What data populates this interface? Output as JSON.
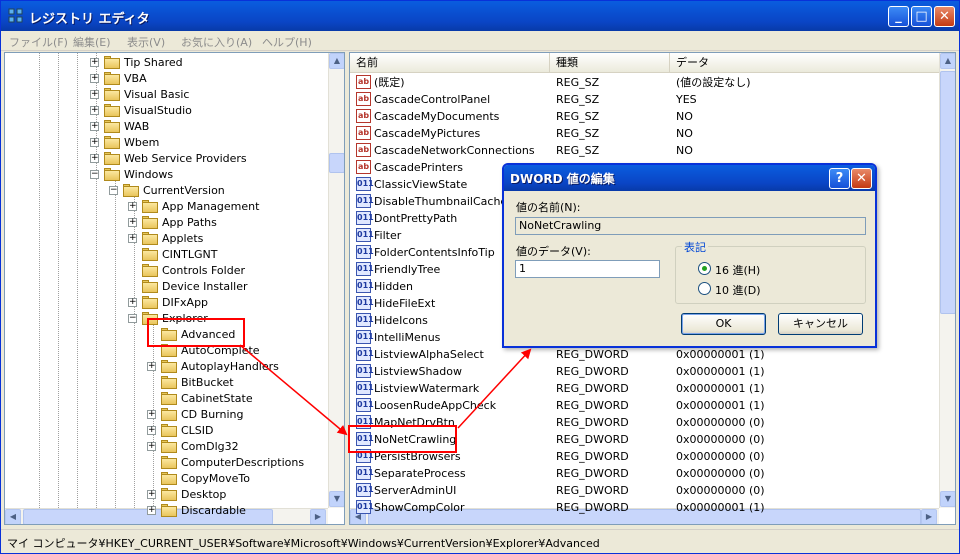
{
  "window": {
    "title": "レジストリ エディタ",
    "buttons": {
      "minimize": "_",
      "maximize": "□",
      "close": "✕"
    }
  },
  "menu": [
    "ファイル(F)",
    "編集(E)",
    "表示(V)",
    "お気に入り(A)",
    "ヘルプ(H)"
  ],
  "tree": {
    "items": [
      {
        "label": "Tip Shared",
        "level": 0,
        "exp": "+"
      },
      {
        "label": "VBA",
        "level": 0,
        "exp": "+"
      },
      {
        "label": "Visual Basic",
        "level": 0,
        "exp": "+"
      },
      {
        "label": "VisualStudio",
        "level": 0,
        "exp": "+"
      },
      {
        "label": "WAB",
        "level": 0,
        "exp": "+"
      },
      {
        "label": "Wbem",
        "level": 0,
        "exp": "+"
      },
      {
        "label": "Web Service Providers",
        "level": 0,
        "exp": "+"
      },
      {
        "label": "Windows",
        "level": 0,
        "exp": "-"
      },
      {
        "label": "CurrentVersion",
        "level": 1,
        "exp": "-"
      },
      {
        "label": "App Management",
        "level": 2,
        "exp": "+"
      },
      {
        "label": "App Paths",
        "level": 2,
        "exp": "+"
      },
      {
        "label": "Applets",
        "level": 2,
        "exp": "+"
      },
      {
        "label": "CINTLGNT",
        "level": 2,
        "exp": ""
      },
      {
        "label": "Controls Folder",
        "level": 2,
        "exp": ""
      },
      {
        "label": "Device Installer",
        "level": 2,
        "exp": ""
      },
      {
        "label": "DIFxApp",
        "level": 2,
        "exp": "+"
      },
      {
        "label": "Explorer",
        "level": 2,
        "exp": "-"
      },
      {
        "label": "Advanced",
        "level": 3,
        "exp": ""
      },
      {
        "label": "AutoComplete",
        "level": 3,
        "exp": ""
      },
      {
        "label": "AutoplayHandlers",
        "level": 3,
        "exp": "+"
      },
      {
        "label": "BitBucket",
        "level": 3,
        "exp": ""
      },
      {
        "label": "CabinetState",
        "level": 3,
        "exp": ""
      },
      {
        "label": "CD Burning",
        "level": 3,
        "exp": "+"
      },
      {
        "label": "CLSID",
        "level": 3,
        "exp": "+"
      },
      {
        "label": "ComDlg32",
        "level": 3,
        "exp": "+"
      },
      {
        "label": "ComputerDescriptions",
        "level": 3,
        "exp": ""
      },
      {
        "label": "CopyMoveTo",
        "level": 3,
        "exp": ""
      },
      {
        "label": "Desktop",
        "level": 3,
        "exp": "+"
      },
      {
        "label": "Discardable",
        "level": 3,
        "exp": "+"
      }
    ]
  },
  "list": {
    "columns": [
      "名前",
      "種類",
      "データ"
    ],
    "rows": [
      {
        "icon": "ab",
        "name": "(既定)",
        "type": "REG_SZ",
        "data": "(値の設定なし)"
      },
      {
        "icon": "ab",
        "name": "CascadeControlPanel",
        "type": "REG_SZ",
        "data": "YES"
      },
      {
        "icon": "ab",
        "name": "CascadeMyDocuments",
        "type": "REG_SZ",
        "data": "NO"
      },
      {
        "icon": "ab",
        "name": "CascadeMyPictures",
        "type": "REG_SZ",
        "data": "NO"
      },
      {
        "icon": "ab",
        "name": "CascadeNetworkConnections",
        "type": "REG_SZ",
        "data": "NO"
      },
      {
        "icon": "ab",
        "name": "CascadePrinters",
        "type": "",
        "data": ""
      },
      {
        "icon": "dw",
        "name": "ClassicViewState",
        "type": "",
        "data": ""
      },
      {
        "icon": "dw",
        "name": "DisableThumbnailCache",
        "type": "",
        "data": ""
      },
      {
        "icon": "dw",
        "name": "DontPrettyPath",
        "type": "",
        "data": ""
      },
      {
        "icon": "dw",
        "name": "Filter",
        "type": "",
        "data": ""
      },
      {
        "icon": "dw",
        "name": "FolderContentsInfoTip",
        "type": "",
        "data": ""
      },
      {
        "icon": "dw",
        "name": "FriendlyTree",
        "type": "",
        "data": ""
      },
      {
        "icon": "dw",
        "name": "Hidden",
        "type": "",
        "data": ""
      },
      {
        "icon": "dw",
        "name": "HideFileExt",
        "type": "",
        "data": ""
      },
      {
        "icon": "dw",
        "name": "HideIcons",
        "type": "",
        "data": ""
      },
      {
        "icon": "dw",
        "name": "IntelliMenus",
        "type": "",
        "data": ""
      },
      {
        "icon": "dw",
        "name": "ListviewAlphaSelect",
        "type": "REG_DWORD",
        "data": "0x00000001 (1)"
      },
      {
        "icon": "dw",
        "name": "ListviewShadow",
        "type": "REG_DWORD",
        "data": "0x00000001 (1)"
      },
      {
        "icon": "dw",
        "name": "ListviewWatermark",
        "type": "REG_DWORD",
        "data": "0x00000001 (1)"
      },
      {
        "icon": "dw",
        "name": "LoosenRudeAppCheck",
        "type": "REG_DWORD",
        "data": "0x00000001 (1)"
      },
      {
        "icon": "dw",
        "name": "MapNetDrvBtn",
        "type": "REG_DWORD",
        "data": "0x00000000 (0)"
      },
      {
        "icon": "dw",
        "name": "NoNetCrawling",
        "type": "REG_DWORD",
        "data": "0x00000000 (0)"
      },
      {
        "icon": "dw",
        "name": "PersistBrowsers",
        "type": "REG_DWORD",
        "data": "0x00000000 (0)"
      },
      {
        "icon": "dw",
        "name": "SeparateProcess",
        "type": "REG_DWORD",
        "data": "0x00000000 (0)"
      },
      {
        "icon": "dw",
        "name": "ServerAdminUI",
        "type": "REG_DWORD",
        "data": "0x00000000 (0)"
      },
      {
        "icon": "dw",
        "name": "ShowCompColor",
        "type": "REG_DWORD",
        "data": "0x00000001 (1)"
      }
    ]
  },
  "status": "マイ コンピュータ¥HKEY_CURRENT_USER¥Software¥Microsoft¥Windows¥CurrentVersion¥Explorer¥Advanced",
  "dialog": {
    "title": "DWORD 値の編集",
    "help": "?",
    "close": "✕",
    "name_label": "値の名前(N):",
    "name_value": "NoNetCrawling",
    "data_label": "値のデータ(V):",
    "data_value": "1",
    "base_legend": "表記",
    "hex_label": "16 進(H)",
    "dec_label": "10 進(D)",
    "ok": "OK",
    "cancel": "キャンセル"
  },
  "colors": {
    "highlight": "#ff0000",
    "titlebar": "#0a5ddf"
  }
}
